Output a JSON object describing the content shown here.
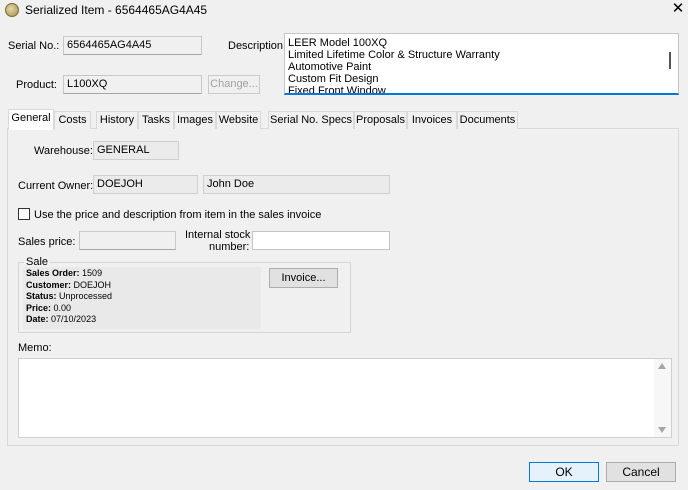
{
  "window": {
    "title": "Serialized Item - 6564465AG4A45"
  },
  "header": {
    "serial_label": "Serial No.:",
    "serial_value": "6564465AG4A45",
    "product_label": "Product:",
    "product_value": "L100XQ",
    "change_button": "Change...",
    "description_label": "Description:",
    "description_lines": [
      "LEER Model 100XQ",
      "Limited Lifetime Color & Structure Warranty",
      "Automotive Paint",
      "Custom Fit Design",
      "Fixed Front Window"
    ]
  },
  "tabs": [
    {
      "label": "General",
      "active": true
    },
    {
      "label": "Costs"
    },
    {
      "label": "History"
    },
    {
      "label": "Tasks"
    },
    {
      "label": "Images"
    },
    {
      "label": "Website"
    },
    {
      "label": "Serial No. Specs"
    },
    {
      "label": "Proposals"
    },
    {
      "label": "Invoices"
    },
    {
      "label": "Documents"
    }
  ],
  "general": {
    "warehouse_label": "Warehouse:",
    "warehouse_value": "GENERAL",
    "owner_label": "Current Owner:",
    "owner_code": "DOEJOH",
    "owner_name": "John Doe",
    "use_price_checkbox_label": "Use the price and description from item in the sales invoice",
    "use_price_checked": false,
    "sales_price_label": "Sales price:",
    "sales_price_value": "",
    "internal_stock_label_1": "Internal stock",
    "internal_stock_label_2": "number:",
    "internal_stock_value": "",
    "sale": {
      "group_title": "Sale",
      "sales_order_label": "Sales Order:",
      "sales_order_value": "1509",
      "customer_label": "Customer:",
      "customer_value": "DOEJOH",
      "status_label": "Status:",
      "status_value": "Unprocessed",
      "price_label": "Price:",
      "price_value": "0.00",
      "date_label": "Date:",
      "date_value": "07/10/2023",
      "invoice_button": "Invoice..."
    },
    "memo_label": "Memo:",
    "memo_value": ""
  },
  "footer": {
    "ok_button": "OK",
    "cancel_button": "Cancel"
  },
  "colors": {
    "accent": "#0078d7",
    "window_bg": "#f0f0f0"
  }
}
